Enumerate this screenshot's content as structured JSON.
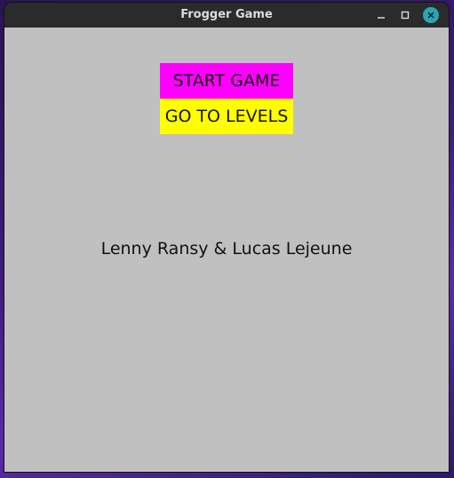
{
  "window": {
    "title": "Frogger Game",
    "controls": {
      "minimize_icon": "minimize-icon",
      "maximize_icon": "maximize-icon",
      "close_icon": "close-icon"
    }
  },
  "menu": {
    "start_label": "START GAME",
    "levels_label": "GO TO LEVELS"
  },
  "credits": "Lenny Ransy & Lucas Lejeune",
  "colors": {
    "background": "#c0c0c0",
    "start_button": "#ff00ff",
    "levels_button": "#ffff00",
    "titlebar": "#2b2b2b",
    "close_button": "#2aa6b8"
  }
}
